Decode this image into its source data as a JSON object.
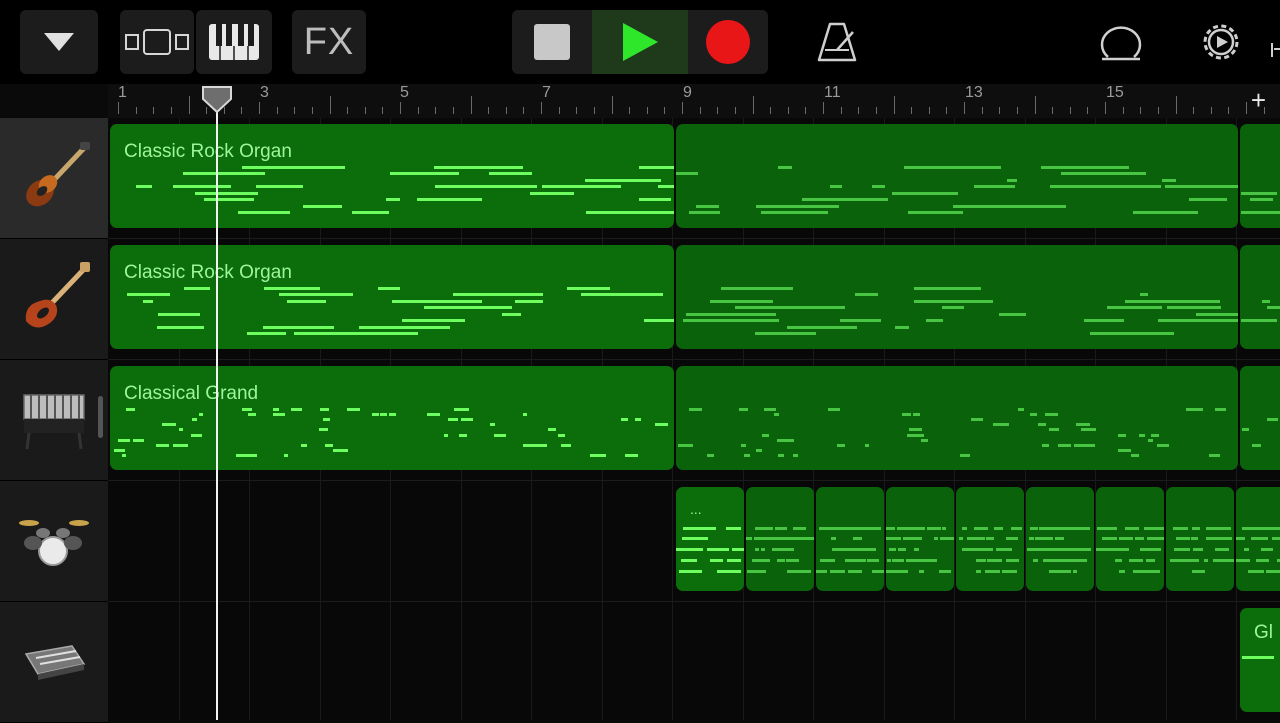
{
  "toolbar": {
    "fx_label": "FX",
    "icons": [
      "dropdown-triangle-icon",
      "tracks-view-icon",
      "keyboard-icon",
      "stop-icon",
      "play-icon",
      "record-icon",
      "metronome-icon",
      "loop-icon",
      "settings-icon"
    ],
    "colors": {
      "record": "#e81616",
      "play": "#2ee62a",
      "background": "#000000"
    }
  },
  "ruler": {
    "bar_labels": [
      "1",
      "3",
      "5",
      "7",
      "9",
      "11",
      "13",
      "15"
    ],
    "add_icon": "+"
  },
  "tracks": [
    {
      "instrument_icon": "violin-bass-guitar-icon",
      "region_label": "Classic Rock Organ"
    },
    {
      "instrument_icon": "electric-bass-guitar-icon",
      "region_label": "Classic Rock Organ"
    },
    {
      "instrument_icon": "vibraphone-icon",
      "region_label": "Classical Grand"
    },
    {
      "instrument_icon": "drum-kit-icon",
      "region_label": "..."
    },
    {
      "instrument_icon": "keyboard-controller-icon",
      "region_label": "Gl"
    }
  ],
  "colors": {
    "region_fill": "#0b6e0b",
    "note": "#6dff60",
    "region_text": "#9ff59b"
  }
}
